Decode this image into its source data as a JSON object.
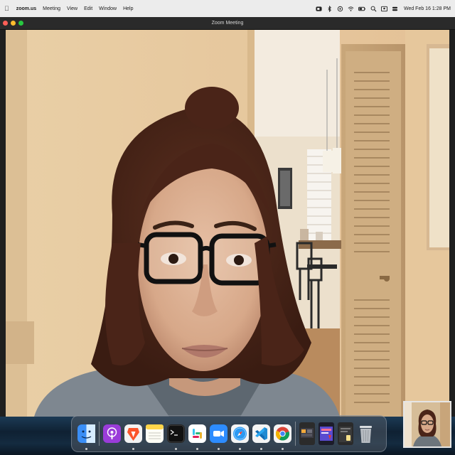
{
  "menubar": {
    "app_name": "zoom.us",
    "menus": [
      "Meeting",
      "View",
      "Edit",
      "Window",
      "Help"
    ],
    "clock": "Wed Feb 16  1:28 PM"
  },
  "window": {
    "title": "Zoom Meeting"
  },
  "status_icons": [
    "zoom-status-icon",
    "bluetooth-icon",
    "focus-icon",
    "wifi-icon",
    "battery-icon",
    "spotlight-search-icon",
    "user-switch-icon",
    "control-center-icon"
  ],
  "dock": {
    "apps": [
      "finder-icon",
      "podcasts-icon",
      "brave-browser-icon",
      "notes-icon",
      "terminal-icon",
      "slack-icon",
      "zoom-icon",
      "safari-icon",
      "vscode-icon",
      "chrome-icon"
    ],
    "recent_windows": [
      "window-thumbnail-1",
      "window-thumbnail-2",
      "window-thumbnail-3"
    ],
    "trash": "trash-icon"
  },
  "colors": {
    "menubar_bg": "#ececec",
    "titlebar_bg": "#2a2a2a",
    "zoom_blue": "#2d8cff",
    "wall": "#e8c8a0"
  }
}
